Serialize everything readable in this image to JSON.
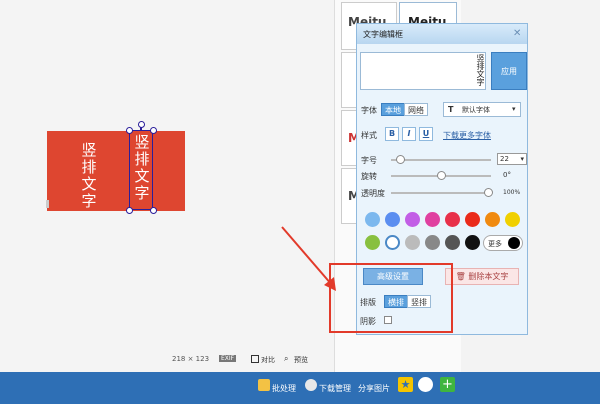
{
  "canvas": {
    "text_left": "竖排文字",
    "text_right": "竖排文字",
    "dims": "218 × 123",
    "exif": "EXIF",
    "compare": "对比",
    "preview": "预览"
  },
  "thumbs": [
    "Meitu",
    "Meitu",
    "",
    "M",
    "M"
  ],
  "bottombar": {
    "batch": "批处理",
    "download_manager": "下载管理",
    "share_image": "分享图片"
  },
  "panel": {
    "title": "文字编辑框",
    "textarea_value": "竖排文字",
    "apply": "应用",
    "font_label": "字体",
    "font_local": "本地",
    "font_web": "网络",
    "font_selected": "默认字体",
    "style_label": "样式",
    "bold": "B",
    "italic": "I",
    "underline": "U",
    "download_more_fonts": "下载更多字体",
    "size_label": "字号",
    "size_value": "22",
    "rotate_label": "旋转",
    "rotate_value": "0°",
    "opacity_label": "透明度",
    "opacity_value": "100%",
    "more": "更多",
    "advanced": "高级设置",
    "delete": "删除本文字",
    "layout_label": "排版",
    "horizontal": "横排",
    "vertical": "竖排",
    "shadow_label": "阴影"
  },
  "colors": {
    "row1": [
      "#7cb8ee",
      "#5b8ef0",
      "#c25ee6",
      "#e040a0",
      "#e8304a",
      "#ea2a1a",
      "#f08a10",
      "#f0d000"
    ],
    "row2": [
      "#88c040",
      "#ffffff",
      "#bbbbbb",
      "#888888",
      "#555555",
      "#111111"
    ],
    "more_swatch": "#000000",
    "banner": "#de4630",
    "bottombar": "#2e6fb5",
    "highlight": "#e23a2a"
  },
  "sliders": {
    "size": 0.05,
    "rotate": 0.5,
    "opacity": 1.0
  }
}
